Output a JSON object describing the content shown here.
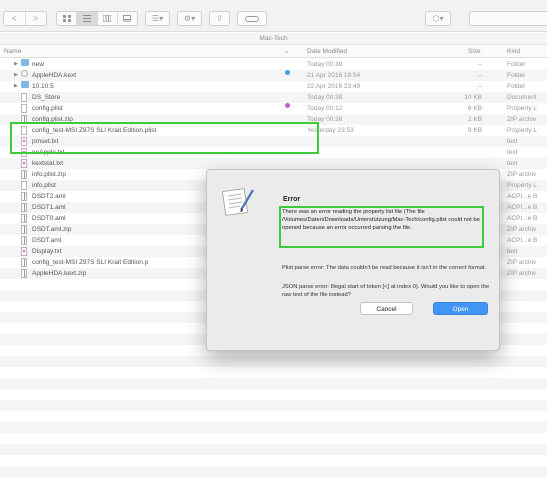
{
  "toolbar": {
    "back_label": "<",
    "forward_label": ">",
    "action_label": "⚙▾",
    "share_label": "⇪",
    "arrange_label": "☰▾",
    "dropbox_label": "⬡▾"
  },
  "pathbar": {
    "folder": "Mac-Tech"
  },
  "columns": {
    "name": "Name",
    "date": "Date Modified",
    "size": "Size",
    "kind": "Kind"
  },
  "files": [
    {
      "name": "new",
      "date": "Today 00:38",
      "size": "--",
      "kind": "Folder",
      "icon": "folder",
      "disclosure": true
    },
    {
      "name": "AppleHDA.kext",
      "date": "21 Apr 2016 19:54",
      "size": "--",
      "kind": "Folder",
      "icon": "package",
      "disclosure": true,
      "tag": "#3f9fe0"
    },
    {
      "name": "10.10.5",
      "date": "22 Apr 2016 23:49",
      "size": "--",
      "kind": "Folder",
      "icon": "folder",
      "disclosure": true
    },
    {
      "name": "DS_Store",
      "date": "Today 00:38",
      "size": "10 KB",
      "kind": "Document",
      "icon": "document"
    },
    {
      "name": "config.plist",
      "date": "Today 00:12",
      "size": "6 KB",
      "kind": "Property L",
      "icon": "document",
      "tag": "#c062d1"
    },
    {
      "name": "config.plist.zip",
      "date": "Today 00:38",
      "size": "2 KB",
      "kind": "ZIP archiv",
      "icon": "zip"
    },
    {
      "name": "config_test-MSI Z97S SLI Krait Edition.plist",
      "date": "Yesterday 23:53",
      "size": "9 KB",
      "kind": "Property L",
      "icon": "document"
    },
    {
      "name": "pmset.txt",
      "date": "",
      "size": "",
      "kind": "text",
      "icon": "text"
    },
    {
      "name": "noApple.txt",
      "date": "",
      "size": "",
      "kind": "text",
      "icon": "text"
    },
    {
      "name": "kextstat.txt",
      "date": "",
      "size": "",
      "kind": "text",
      "icon": "text"
    },
    {
      "name": "info.plist.zip",
      "date": "",
      "size": "",
      "kind": "ZIP archiv",
      "icon": "zip"
    },
    {
      "name": "info.plist",
      "date": "",
      "size": "",
      "kind": "Property L",
      "icon": "document"
    },
    {
      "name": "DSDT2.aml",
      "date": "",
      "size": "",
      "kind": "ACPI...e B",
      "icon": "aml"
    },
    {
      "name": "DSDT1.aml",
      "date": "",
      "size": "",
      "kind": "ACPI...e B",
      "icon": "aml"
    },
    {
      "name": "DSDT0.aml",
      "date": "",
      "size": "",
      "kind": "ACPI...e B",
      "icon": "aml"
    },
    {
      "name": "DSDT.aml.zip",
      "date": "",
      "size": "",
      "kind": "ZIP archiv",
      "icon": "zip"
    },
    {
      "name": "DSDT.aml",
      "date": "",
      "size": "",
      "kind": "ACPI...e B",
      "icon": "aml"
    },
    {
      "name": "Display.txt",
      "date": "",
      "size": "",
      "kind": "text",
      "icon": "text"
    },
    {
      "name": "config_test-MSI Z97S SLI Krait Edition.p",
      "date": "",
      "size": "",
      "kind": "ZIP archiv",
      "icon": "zip"
    },
    {
      "name": "AppleHDA.kext.zip",
      "date": "",
      "size": "",
      "kind": "ZIP archiv",
      "icon": "zip"
    }
  ],
  "dialog": {
    "title": "Error",
    "message": "There was an error reading the property list file (The file /Volumes/Daten/Downloads/Unterstützung/Mac-Tech/config.plist could not be opened because an error occurred parsing the file.",
    "plist_error": "Plist parse error: The data couldn't be read because it isn't in the correct format.",
    "json_error": "JSON parse error: Illegal start of token [<] at index 0). Would you like to open the raw text of the file instead?",
    "cancel_label": "Cancel",
    "open_label": "Open"
  },
  "colors": {
    "accent": "#4196f5",
    "highlight": "#3ecb3a",
    "folder": "#7fb8e6"
  }
}
